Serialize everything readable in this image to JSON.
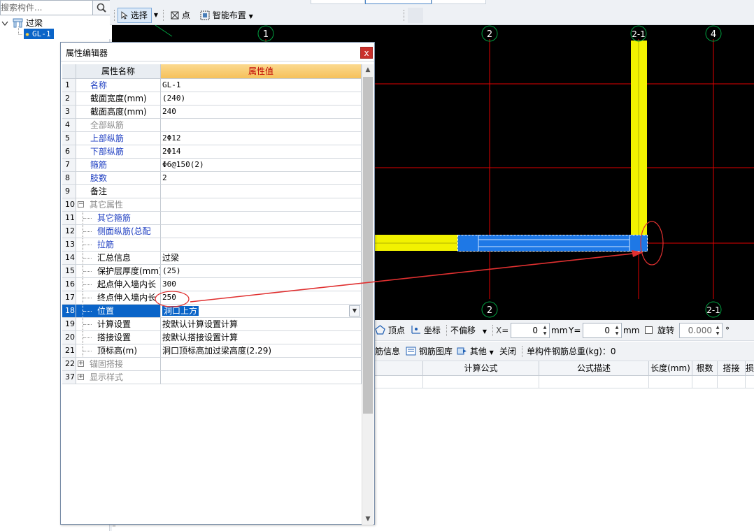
{
  "search": {
    "placeholder": "搜索构件..."
  },
  "tree": {
    "parent": "过梁",
    "child": "GL-1"
  },
  "toolbar": {
    "select_label": "选择",
    "point_label": "点",
    "smart_label": "智能布置"
  },
  "canvas": {
    "axis_labels_top": [
      "1",
      "2",
      "2-1",
      "4"
    ],
    "axis_labels_bottom": [
      "2",
      "2-1"
    ],
    "colors": {
      "background": "#000000",
      "grid_line": "#e00000",
      "wall": "#f2f200",
      "lintel": "#1e78e6"
    }
  },
  "dialog": {
    "title": "属性编辑器",
    "close_label": "x",
    "header_name": "属性名称",
    "header_value": "属性值",
    "rows": [
      {
        "num": "1",
        "name": "名称",
        "value": "GL-1",
        "style": "blue"
      },
      {
        "num": "2",
        "name": "截面宽度(mm)",
        "value": "(240)",
        "style": "black"
      },
      {
        "num": "3",
        "name": "截面高度(mm)",
        "value": "240",
        "style": "black"
      },
      {
        "num": "4",
        "name": "全部纵筋",
        "value": "",
        "style": "gray"
      },
      {
        "num": "5",
        "name": "上部纵筋",
        "value": "2Φ12",
        "style": "blue"
      },
      {
        "num": "6",
        "name": "下部纵筋",
        "value": "2Φ14",
        "style": "blue"
      },
      {
        "num": "7",
        "name": "箍筋",
        "value": "Φ6@150(2)",
        "style": "blue"
      },
      {
        "num": "8",
        "name": "肢数",
        "value": "2",
        "style": "blue"
      },
      {
        "num": "9",
        "name": "备注",
        "value": "",
        "style": "black"
      },
      {
        "num": "10",
        "name": "其它属性",
        "value": "",
        "style": "gray",
        "expander": "−"
      },
      {
        "num": "11",
        "name": "其它箍筋",
        "value": "",
        "style": "blue",
        "child": true
      },
      {
        "num": "12",
        "name": "侧面纵筋(总配",
        "value": "",
        "style": "blue",
        "child": true
      },
      {
        "num": "13",
        "name": "拉筋",
        "value": "",
        "style": "blue",
        "child": true
      },
      {
        "num": "14",
        "name": "汇总信息",
        "value": "过梁",
        "style": "black",
        "child": true,
        "cn": true
      },
      {
        "num": "15",
        "name": "保护层厚度(mm)",
        "value": "(25)",
        "style": "black",
        "child": true
      },
      {
        "num": "16",
        "name": "起点伸入墙内长",
        "value": "300",
        "style": "black",
        "child": true
      },
      {
        "num": "17",
        "name": "终点伸入墙内长",
        "value": "250",
        "style": "black",
        "child": true
      },
      {
        "num": "18",
        "name": "位置",
        "value": "洞口上方",
        "style": "black",
        "child": true,
        "selected": true,
        "cn": true
      },
      {
        "num": "19",
        "name": "计算设置",
        "value": "按默认计算设置计算",
        "style": "black",
        "child": true,
        "cn": true
      },
      {
        "num": "20",
        "name": "搭接设置",
        "value": "按默认搭接设置计算",
        "style": "black",
        "child": true,
        "cn": true
      },
      {
        "num": "21",
        "name": "顶标高(m)",
        "value": "洞口顶标高加过梁高度(2.29)",
        "style": "black",
        "child": true,
        "cn": true
      },
      {
        "num": "22",
        "name": "锚固搭接",
        "value": "",
        "style": "gray",
        "expander": "+"
      },
      {
        "num": "37",
        "name": "显示样式",
        "value": "",
        "style": "gray",
        "expander": "+"
      }
    ]
  },
  "bottombar": {
    "vertex_label": "顶点",
    "coord_label": "坐标",
    "offset_label": "不偏移",
    "x_label": "X=",
    "x_value": "0",
    "unit1": "mm",
    "y_label": "Y=",
    "y_value": "0",
    "unit2": "mm",
    "rotate_label": "旋转",
    "rotate_value": "0.000",
    "degree": "°"
  },
  "bottombar2": {
    "info_label": "筋信息",
    "library_label": "钢筋图库",
    "other_label": "其他",
    "close_label": "关闭",
    "weight_label": "单构件钢筋总重(kg)：0"
  },
  "rebar_table": {
    "headers": [
      "计算公式",
      "公式描述",
      "长度(mm)",
      "根数",
      "搭接",
      "损"
    ]
  }
}
